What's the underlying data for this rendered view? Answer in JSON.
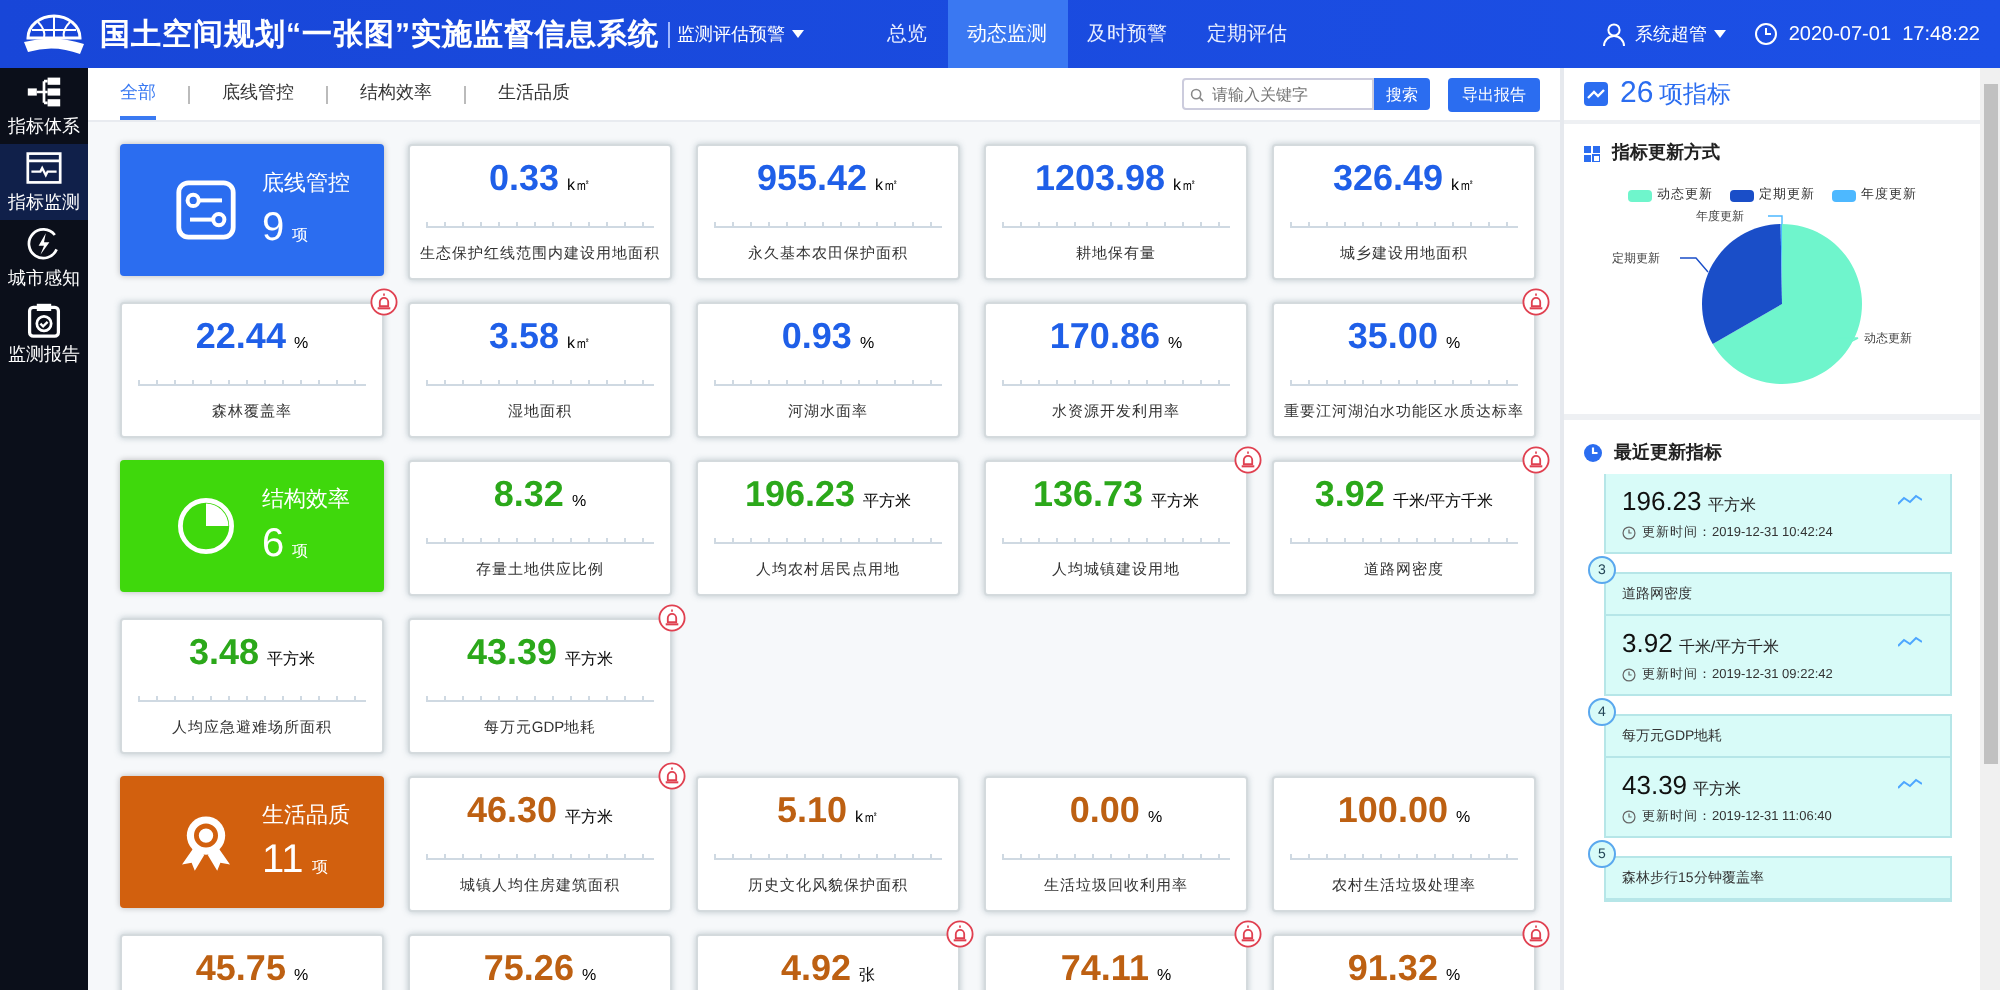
{
  "header": {
    "title": "国土空间规划“一张图”实施监督信息系统",
    "subsystem": "监测评估预警",
    "nav": [
      {
        "label": "总览",
        "selected": false
      },
      {
        "label": "动态监测",
        "selected": true
      },
      {
        "label": "及时预警",
        "selected": false
      },
      {
        "label": "定期评估",
        "selected": false
      }
    ],
    "user": "系统超管",
    "datetime": "2020-07-01  17:48:22"
  },
  "sidebar": {
    "items": [
      {
        "label": "指标体系",
        "kind": "tree",
        "selected": false
      },
      {
        "label": "指标监测",
        "kind": "monitor",
        "selected": true
      },
      {
        "label": "城市感知",
        "kind": "sense",
        "selected": false
      },
      {
        "label": "监测报告",
        "kind": "report",
        "selected": false
      }
    ]
  },
  "tabs": [
    {
      "label": "全部",
      "selected": true
    },
    {
      "label": "底线管控",
      "selected": false
    },
    {
      "label": "结构效率",
      "selected": false
    },
    {
      "label": "生活品质",
      "selected": false
    }
  ],
  "search": {
    "placeholder": "请输入关键字",
    "button": "搜索"
  },
  "export_button": "导出报告",
  "groups": [
    {
      "kind": "baseline",
      "title": "底线管控",
      "count": "9",
      "count_unit": "项",
      "metrics": [
        {
          "value": "0.33",
          "unit": "k㎡",
          "label": "生态保护红线范围内建设用地面积",
          "alarm": false
        },
        {
          "value": "955.42",
          "unit": "k㎡",
          "label": "永久基本农田保护面积",
          "alarm": false
        },
        {
          "value": "1203.98",
          "unit": "k㎡",
          "label": "耕地保有量",
          "alarm": false
        },
        {
          "value": "326.49",
          "unit": "k㎡",
          "label": "城乡建设用地面积",
          "alarm": false
        },
        {
          "value": "22.44",
          "unit": "%",
          "label": "森林覆盖率",
          "alarm": true
        },
        {
          "value": "3.58",
          "unit": "k㎡",
          "label": "湿地面积",
          "alarm": false
        },
        {
          "value": "0.93",
          "unit": "%",
          "label": "河湖水面率",
          "alarm": false
        },
        {
          "value": "170.86",
          "unit": "%",
          "label": "水资源开发利用率",
          "alarm": false
        },
        {
          "value": "35.00",
          "unit": "%",
          "label": "重要江河湖泊水功能区水质达标率",
          "alarm": true
        }
      ]
    },
    {
      "kind": "structure",
      "title": "结构效率",
      "count": "6",
      "count_unit": "项",
      "metrics": [
        {
          "value": "8.32",
          "unit": "%",
          "label": "存量土地供应比例",
          "alarm": false
        },
        {
          "value": "196.23",
          "unit": "平方米",
          "label": "人均农村居民点用地",
          "alarm": false
        },
        {
          "value": "136.73",
          "unit": "平方米",
          "label": "人均城镇建设用地",
          "alarm": true
        },
        {
          "value": "3.92",
          "unit": "千米/平方千米",
          "label": "道路网密度",
          "alarm": true
        },
        {
          "value": "3.48",
          "unit": "平方米",
          "label": "人均应急避难场所面积",
          "alarm": false
        },
        {
          "value": "43.39",
          "unit": "平方米",
          "label": "每万元GDP地耗",
          "alarm": true
        }
      ]
    },
    {
      "kind": "life",
      "title": "生活品质",
      "count": "11",
      "count_unit": "项",
      "metrics": [
        {
          "value": "46.30",
          "unit": "平方米",
          "label": "城镇人均住房建筑面积",
          "alarm": true
        },
        {
          "value": "5.10",
          "unit": "k㎡",
          "label": "历史文化风貌保护面积",
          "alarm": false
        },
        {
          "value": "0.00",
          "unit": "%",
          "label": "生活垃圾回收利用率",
          "alarm": false
        },
        {
          "value": "100.00",
          "unit": "%",
          "label": "农村生活垃圾处理率",
          "alarm": false
        },
        {
          "value": "45.75",
          "unit": "%",
          "alarm": false
        },
        {
          "value": "75.26",
          "unit": "%",
          "alarm": false
        },
        {
          "value": "4.92",
          "unit": "张",
          "alarm": true
        },
        {
          "value": "74.11",
          "unit": "%",
          "alarm": true
        },
        {
          "value": "91.32",
          "unit": "%",
          "alarm": true
        }
      ]
    }
  ],
  "summary": {
    "count": "26",
    "label": "项指标"
  },
  "update_modes": {
    "title": "指标更新方式",
    "legend": [
      {
        "label": "动态更新",
        "color": "#6ff5cc"
      },
      {
        "label": "定期更新",
        "color": "#1a4ec8"
      },
      {
        "label": "年度更新",
        "color": "#4db8ff"
      }
    ],
    "slice_labels": [
      "年度更新",
      "定期更新",
      "动态更新"
    ]
  },
  "recent": {
    "title": "最近更新指标",
    "items": [
      {
        "value": "196.23",
        "unit": "平方米",
        "time_label": "更新时间：",
        "time": "2019-12-31 10:42:24"
      },
      {
        "index": "3",
        "name": "道路网密度",
        "value": "3.92",
        "unit": "千米/平方千米",
        "time_label": "更新时间：",
        "time": "2019-12-31 09:22:42"
      },
      {
        "index": "4",
        "name": "每万元GDP地耗",
        "value": "43.39",
        "unit": "平方米",
        "time_label": "更新时间：",
        "time": "2019-12-31 11:06:40"
      },
      {
        "index": "5",
        "name": "森林步行15分钟覆盖率"
      }
    ]
  }
}
